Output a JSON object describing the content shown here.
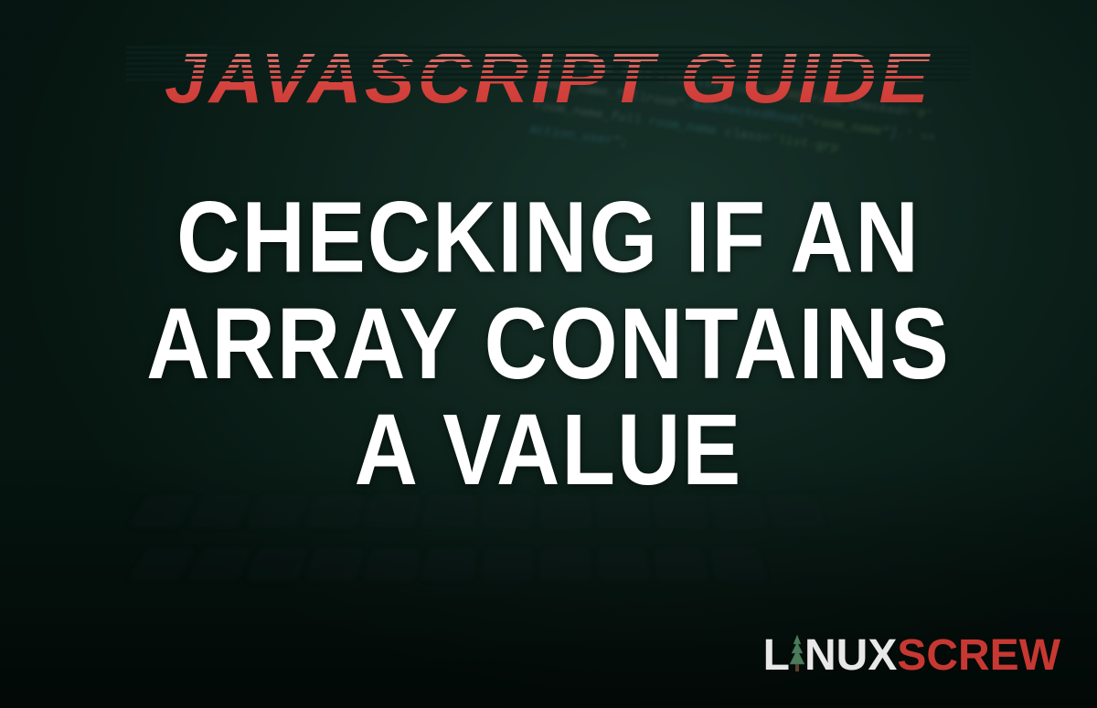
{
  "header": {
    "category_label": "JAVASCRIPT GUIDE"
  },
  "main": {
    "title_line1": "CHECKING IF AN",
    "title_line2": "ARRAY CONTAINS",
    "title_line3": "A VALUE"
  },
  "logo": {
    "part1": "L",
    "part2": "NUX",
    "part3": "SCREW",
    "tree_icon": "pine-tree"
  },
  "background_code": {
    "lines": [
      "room_name_full LIKE tbl_room WHERE room_checked='0'",
      "room_name_fullroom\".$uncheckedRoom[\"room_name\"].' ==",
      "room_name_full room_name class='list-grp",
      "action_user\";"
    ]
  },
  "colors": {
    "header_gradient_top": "#e8938f",
    "header_gradient_bottom": "#c73832",
    "main_text": "#ffffff",
    "logo_light": "#e8e8e8",
    "logo_accent": "#c73832",
    "background_base": "#0a1f1a"
  }
}
